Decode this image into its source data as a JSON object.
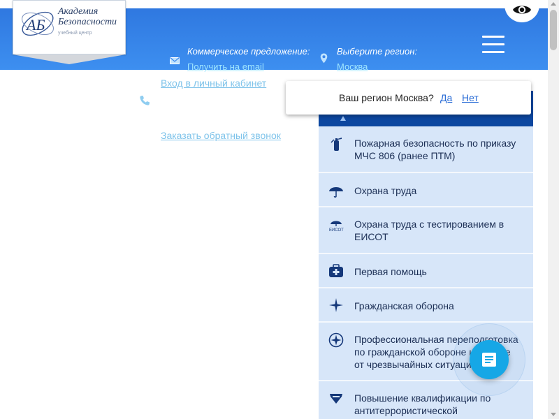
{
  "header": {
    "logo": {
      "mark": "АБ",
      "name_line1": "Академия",
      "name_line2": "Безопасности",
      "subtitle": "учебный центр"
    },
    "offer": {
      "label": "Коммерческое предложение:",
      "link": "Получить на email",
      "icon": "mail-icon"
    },
    "region": {
      "label": "Выберите регион:",
      "link": "Москва",
      "icon": "location-pin-icon"
    },
    "menu_icon": "hamburger-icon",
    "accessibility_icon": "eye-icon"
  },
  "account": {
    "login_link": "Вход в личный кабинет",
    "callback_link": "Заказать обратный звонок",
    "phone_icon": "phone-icon"
  },
  "region_popup": {
    "question": "Ваш регион Москва?",
    "yes": "Да",
    "no": "Нет"
  },
  "menu": {
    "items": [
      {
        "icon": "fire-extinguisher-icon",
        "label": "Пожарная безопасность по приказу МЧС 806 (ранее ПТМ)"
      },
      {
        "icon": "umbrella-icon",
        "label": "Охрана труда"
      },
      {
        "icon": "eisot-umbrella-icon",
        "label": "Охрана труда с тестированием в ЕИСОТ"
      },
      {
        "icon": "first-aid-kit-icon",
        "label": "Первая помощь"
      },
      {
        "icon": "star-icon",
        "label": "Гражданская оборона"
      },
      {
        "icon": "civil-defense-emblem-icon",
        "label": "Профессиональная переподготовка по гражданской обороне и защите от чрезвычайных ситуаций"
      },
      {
        "icon": "shield-icon",
        "label": "Повышение квалификации по антитеррористической"
      }
    ]
  },
  "floating_button": {
    "icon": "document-icon"
  },
  "colors": {
    "header_blue": "#3a86ec",
    "menu_head": "#0c47a0",
    "menu_item_bg": "#d7e6f9",
    "link_light": "#7ec3ea",
    "fab": "#16a7e6"
  }
}
